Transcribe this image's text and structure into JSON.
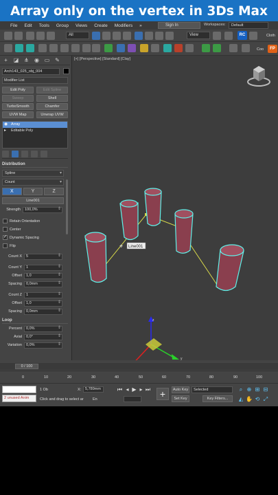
{
  "banner": {
    "title": "Array only on the vertex in 3Ds Max"
  },
  "menu": {
    "items": [
      "File",
      "Edit",
      "Tools",
      "Group",
      "Views",
      "Create",
      "Modifiers",
      "»"
    ],
    "sign_in": "Sign In",
    "workspaces_label": "Workspaces:",
    "workspaces_value": "Default"
  },
  "toolbar": {
    "selection_filter": "All",
    "ref_coord": "View",
    "rc_badge": "RC",
    "fp_badge": "FP",
    "cloth_label": "Cloth",
    "coo_label": "Coo"
  },
  "command_panel": {
    "object_name": "Arch143_025_obj_004",
    "modifier_list": "Modifier List",
    "buttons": [
      {
        "label": "Edit Poly",
        "enabled": true
      },
      {
        "label": "Edit Spline",
        "enabled": false
      },
      {
        "label": "Sweep",
        "enabled": false
      },
      {
        "label": "Shell",
        "enabled": true
      },
      {
        "label": "TurboSmooth",
        "enabled": true
      },
      {
        "label": "Chamfer",
        "enabled": true
      },
      {
        "label": "UVW Map",
        "enabled": true
      },
      {
        "label": "Unwrap UVW",
        "enabled": true
      }
    ],
    "stack": [
      "Array",
      "Editable Poly"
    ],
    "distribution_title": "Distribution",
    "distribution_type": "Spline",
    "count_mode": "Count",
    "axis": [
      "X",
      "Y",
      "Z"
    ],
    "spline_pick": "Line001",
    "strength_label": "Strength",
    "strength_value": "100,0%",
    "retain_orientation": "Retain Orientation",
    "center": "Center",
    "dynamic_spacing": "Dynamic Spacing",
    "flip": "Flip",
    "count_x_label": "Count X",
    "count_x_value": "5",
    "count_y_label": "Count Y",
    "count_y_value": "1",
    "offset_label": "Offset",
    "offset_y_value": "1,0",
    "spacing_label": "Spacing",
    "spacing_y_value": "0,0mm",
    "count_z_label": "Count Z",
    "count_z_value": "1",
    "offset_z_value": "1,0",
    "spacing_z_value": "0,0mm",
    "loop_title": "Loop",
    "percent_label": "Percent",
    "percent_value": "0,0%",
    "axial_label": "Axial",
    "axial_value": "0,0°",
    "variation_label": "Variation",
    "variation_value": "0,0%"
  },
  "viewport": {
    "label": "[+] [Perspective] [Standard] [Clay]",
    "spline_tag": "Line001",
    "axis_labels": [
      "x",
      "y",
      "z"
    ]
  },
  "timeline": {
    "frame_display": "0 / 100",
    "ticks": [
      "0",
      "10",
      "20",
      "30",
      "40",
      "50",
      "60",
      "70",
      "80",
      "90",
      "100"
    ]
  },
  "statusbar": {
    "maxscript_text": "2 unused Anim",
    "selection_count": "1 Ob",
    "prompt": "Click and drag to select ar",
    "x_label": "X:",
    "x_value": "5,789mm",
    "en_label": "En",
    "auto_key": "Auto Key",
    "set_key": "Set Key",
    "selected": "Selected",
    "key_filters": "Key Filters..."
  },
  "colors": {
    "banner_bg": "#1a73c4",
    "pillar_fill": "#8a3f4e",
    "selection_outline": "#5ff2ea",
    "spline_color": "#d7d84a"
  }
}
